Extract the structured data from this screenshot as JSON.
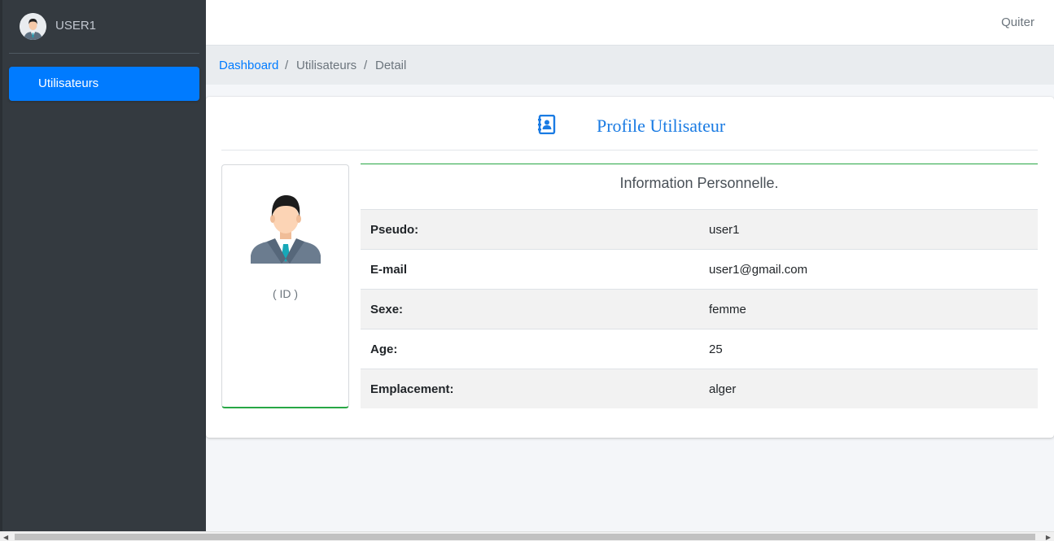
{
  "sidebar": {
    "user_name": "USER1",
    "items": [
      {
        "label": "Utilisateurs",
        "icon": "users-icon",
        "active": true
      }
    ]
  },
  "navbar": {
    "quit_label": "Quiter"
  },
  "breadcrumb": {
    "items": [
      "Dashboard",
      "Utilisateurs",
      "Detail"
    ],
    "separator": "/"
  },
  "profile": {
    "title": "Profile Utilisateur",
    "title_icon": "address-book-icon",
    "photo_caption": "( ID )",
    "info_title": "Information Personnelle.",
    "fields": [
      {
        "label": "Pseudo:",
        "value": "user1"
      },
      {
        "label": "E-mail",
        "value": "user1@gmail.com"
      },
      {
        "label": "Sexe:",
        "value": "femme"
      },
      {
        "label": "Age:",
        "value": "25"
      },
      {
        "label": "Emplacement:",
        "value": "alger"
      }
    ]
  },
  "colors": {
    "accent": "#007bff",
    "sidebar_bg": "#343a40",
    "success_border": "#28a745",
    "title": "#1a7be3"
  }
}
